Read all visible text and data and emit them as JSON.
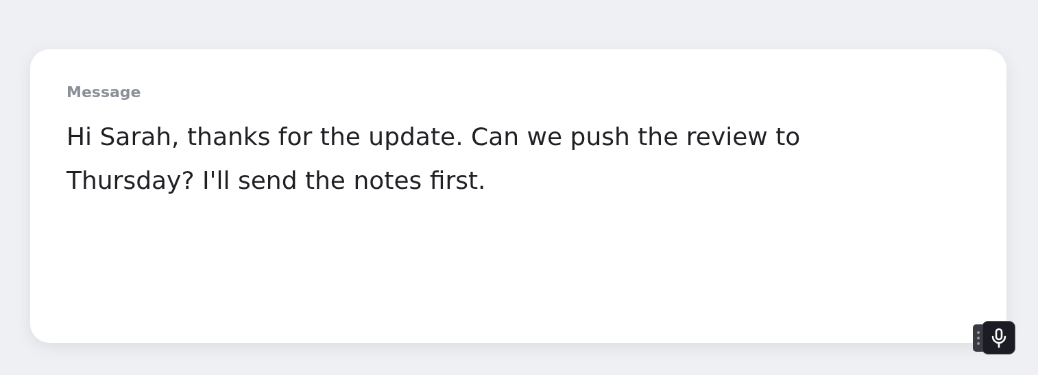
{
  "field": {
    "label": "Message",
    "value": "Hi Sarah, thanks for the update. Can we push the review to Thursday? I'll send the notes first."
  },
  "voice_button": {
    "recording": false
  }
}
